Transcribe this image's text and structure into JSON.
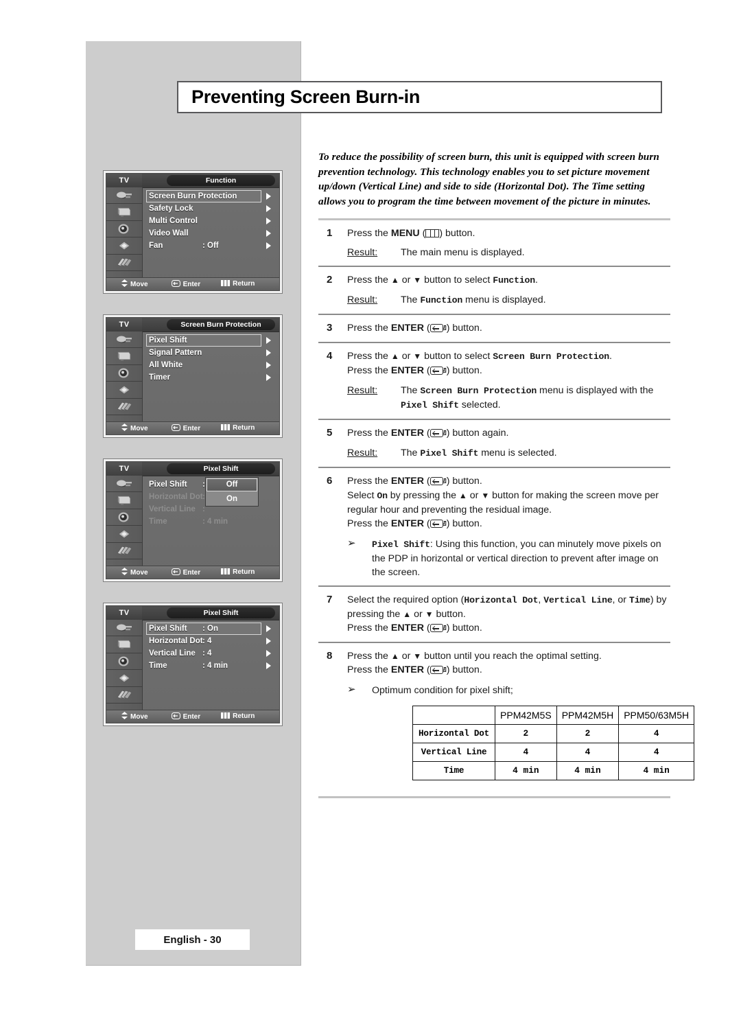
{
  "page": {
    "title": "Preventing Screen Burn-in",
    "footer": "English - 30",
    "intro": "To reduce the possibility of screen burn, this unit is equipped with screen burn prevention technology. This technology enables you to set picture movement up/down (Vertical Line) and side to side (Horizontal Dot). The Time setting allows you to program the time between movement of the picture in minutes."
  },
  "steps": [
    {
      "num": "1",
      "lines": [
        "Press the MENU ( ) button."
      ],
      "result_label": "Result:",
      "result_text": "The main menu is displayed."
    },
    {
      "num": "2",
      "lines": [
        "Press the ▲ or ▼ button to select Function."
      ],
      "result_label": "Result:",
      "result_text": "The Function menu is displayed."
    },
    {
      "num": "3",
      "lines": [
        "Press the ENTER ( ) button."
      ]
    },
    {
      "num": "4",
      "lines": [
        "Press the ▲ or ▼ button to select Screen Burn Protection.",
        "Press the ENTER ( ) button."
      ],
      "result_label": "Result:",
      "result_text": "The Screen Burn Protection menu is displayed with the Pixel Shift selected."
    },
    {
      "num": "5",
      "lines": [
        "Press the ENTER ( ) button again."
      ],
      "result_label": "Result:",
      "result_text": "The Pixel Shift menu is selected."
    },
    {
      "num": "6",
      "lines": [
        "Press the ENTER ( ) button.",
        "Select On by pressing the ▲ or ▼ button for making the screen move per regular hour and preventing the residual image.",
        "Press the ENTER ( ) button."
      ],
      "note": "Pixel Shift: Using this function, you can minutely move pixels on the PDP in horizontal or vertical direction to prevent after image on the screen."
    },
    {
      "num": "7",
      "lines": [
        "Select the required option (Horizontal Dot, Vertical Line, or Time) by pressing the ▲ or ▼ button.",
        "Press the ENTER ( ) button."
      ]
    },
    {
      "num": "8",
      "lines": [
        "Press the ▲ or ▼ button until you reach the optimal setting.",
        "Press the ENTER ( ) button."
      ],
      "note": "Optimum condition for pixel shift;"
    }
  ],
  "spec_table": {
    "columns": [
      "",
      "PPM42M5S",
      "PPM42M5H",
      "PPM50/63M5H"
    ],
    "rows": [
      {
        "label": "Horizontal Dot",
        "values": [
          "2",
          "2",
          "4"
        ]
      },
      {
        "label": "Vertical Line",
        "values": [
          "4",
          "4",
          "4"
        ]
      },
      {
        "label": "Time",
        "values": [
          "4 min",
          "4 min",
          "4 min"
        ]
      }
    ]
  },
  "osd_common": {
    "tv_label": "TV",
    "move": "Move",
    "enter": "Enter",
    "return": "Return"
  },
  "osd_menus": [
    {
      "id": "function-menu",
      "title": "Function",
      "rows": [
        {
          "label": "Screen Burn Protection",
          "value": "",
          "arrow": true,
          "selected": true
        },
        {
          "label": "Safety Lock",
          "value": "",
          "arrow": true,
          "selected": false
        },
        {
          "label": "Multi Control",
          "value": "",
          "arrow": true,
          "selected": false
        },
        {
          "label": "Video Wall",
          "value": "",
          "arrow": true,
          "selected": false
        },
        {
          "label": "Fan",
          "value": ": Off",
          "arrow": true,
          "selected": false
        }
      ]
    },
    {
      "id": "screen-burn-protection-menu",
      "title": "Screen Burn Protection",
      "rows": [
        {
          "label": "Pixel Shift",
          "value": "",
          "arrow": true,
          "selected": true
        },
        {
          "label": "Signal Pattern",
          "value": "",
          "arrow": true,
          "selected": false
        },
        {
          "label": "All White",
          "value": "",
          "arrow": true,
          "selected": false
        },
        {
          "label": "Timer",
          "value": "",
          "arrow": true,
          "selected": false
        }
      ]
    },
    {
      "id": "pixel-shift-menu-popup",
      "title": "Pixel Shift",
      "rows": [
        {
          "label": "Pixel Shift",
          "value": ":",
          "arrow": false,
          "selected": false,
          "dim": false
        },
        {
          "label": "Horizontal Dot",
          "value": ":",
          "arrow": false,
          "selected": false,
          "dim": true
        },
        {
          "label": "Vertical Line",
          "value": ":",
          "arrow": false,
          "selected": false,
          "dim": true
        },
        {
          "label": "Time",
          "value": ": 4 min",
          "arrow": false,
          "selected": false,
          "dim": true
        }
      ],
      "popup": {
        "options": [
          "Off",
          "On"
        ],
        "highlighted": "Off"
      }
    },
    {
      "id": "pixel-shift-menu-values",
      "title": "Pixel Shift",
      "rows": [
        {
          "label": "Pixel Shift",
          "value": ": On",
          "arrow": true,
          "selected": true
        },
        {
          "label": "Horizontal Dot",
          "value": ": 4",
          "arrow": true,
          "selected": false
        },
        {
          "label": "Vertical Line",
          "value": ": 4",
          "arrow": true,
          "selected": false
        },
        {
          "label": "Time",
          "value": ": 4 min",
          "arrow": true,
          "selected": false
        }
      ]
    }
  ],
  "icons": {
    "sidebar": [
      "input-plug-icon",
      "picture-tv-icon",
      "sound-speaker-icon",
      "setup-chip-icon",
      "function-cards-icon"
    ],
    "menu_key": "menu-key-icon",
    "enter_key": "enter-key-icon",
    "move": "up-down-arrows-icon",
    "return": "return-bars-icon",
    "bullet": "arrow-bullet-icon"
  }
}
